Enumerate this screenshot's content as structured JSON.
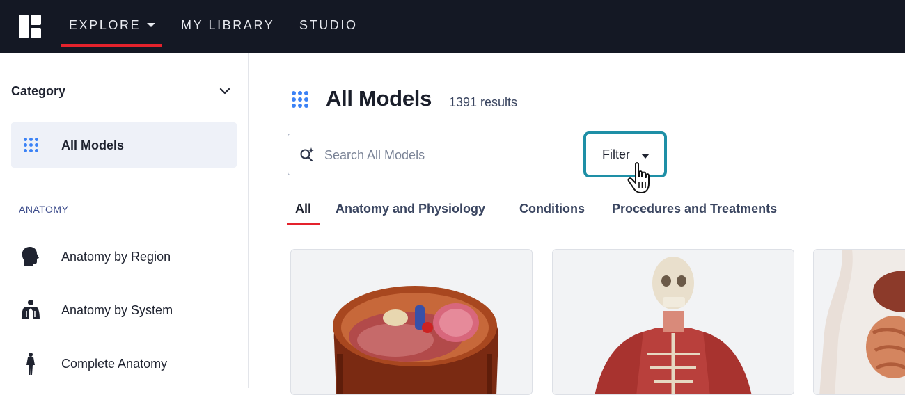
{
  "nav": {
    "logo_icon": "brand-logo-icon",
    "items": [
      {
        "label": "EXPLORE",
        "active": true,
        "has_dropdown": true
      },
      {
        "label": "MY LIBRARY"
      },
      {
        "label": "STUDIO"
      }
    ]
  },
  "sidebar": {
    "category_label": "Category",
    "category_icon": "chevron-down-icon",
    "active_item": {
      "label": "All Models",
      "icon": "grid-dots-icon"
    },
    "section_heading": "ANATOMY",
    "links": [
      {
        "label": "Anatomy by Region",
        "icon": "head-silhouette-icon"
      },
      {
        "label": "Anatomy by System",
        "icon": "lungs-body-icon"
      },
      {
        "label": "Complete Anatomy",
        "icon": "human-figure-icon"
      }
    ]
  },
  "main": {
    "title": "All Models",
    "title_icon": "grid-dots-icon",
    "results": "1391 results",
    "search": {
      "placeholder": "Search All Models",
      "value": "",
      "icon": "search-sparkle-icon"
    },
    "filter": {
      "label": "Filter",
      "icon": "caret-down-icon"
    },
    "cursor_icon": "hand-pointer-cursor-icon",
    "tabs": [
      {
        "label": "All",
        "active": true
      },
      {
        "label": "Anatomy and Physiology"
      },
      {
        "label": "Conditions"
      },
      {
        "label": "Procedures and Treatments"
      }
    ],
    "cards": [
      {
        "image": "abdomen-cross-section-model"
      },
      {
        "image": "muscular-skeleton-torso-model"
      },
      {
        "image": "digestive-organs-model"
      }
    ]
  },
  "colors": {
    "nav_bg": "#141824",
    "accent_red": "#e4222c",
    "accent_blue": "#3b82f6",
    "filter_highlight": "#1e8fa6",
    "active_bg": "#eef1f8"
  }
}
